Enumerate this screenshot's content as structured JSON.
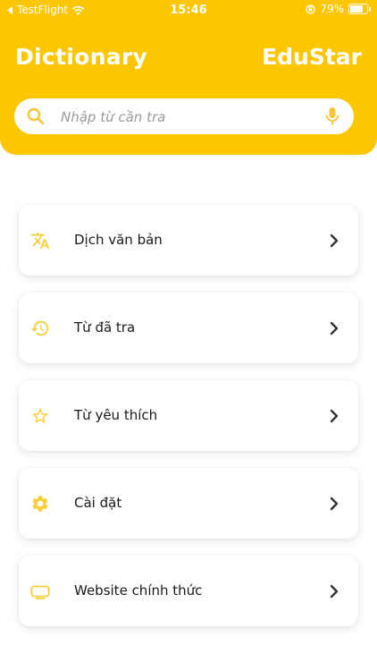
{
  "status_bar": {
    "carrier": "TestFlight",
    "time": "15:46",
    "battery": "79%",
    "battery_level": 0.79
  },
  "header": {
    "title": "Dictionary",
    "brand": "EduStar"
  },
  "search": {
    "placeholder": "Nhập từ cần tra"
  },
  "menu": {
    "items": [
      {
        "label": "Dịch văn bản",
        "icon": "translate-icon"
      },
      {
        "label": "Từ đã tra",
        "icon": "history-icon"
      },
      {
        "label": "Từ yêu thích",
        "icon": "star-icon"
      },
      {
        "label": "Cài đặt",
        "icon": "gear-icon"
      },
      {
        "label": "Website chính thức",
        "icon": "monitor-icon"
      }
    ]
  },
  "colors": {
    "accent": "#FCC701",
    "icon": "#F8CF3B",
    "chevron": "#333333"
  }
}
